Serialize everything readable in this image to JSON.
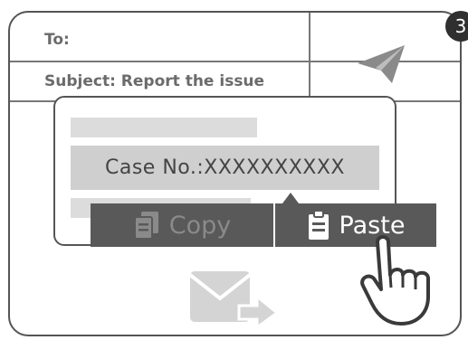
{
  "email": {
    "to_label": "To:",
    "subject_label": "Subject: Report the issue"
  },
  "step_badge": "3",
  "clipboard_text": "Case No.:XXXXXXXXXX",
  "context_menu": {
    "copy_label": "Copy",
    "paste_label": "Paste"
  },
  "colors": {
    "menu_bg": "#595959",
    "case_box_bg": "#cfcfcf",
    "placeholder_bar": "#dcdcdc",
    "outline": "#555555"
  },
  "icons": [
    "send-icon",
    "copy-icon",
    "paste-icon",
    "mail-forward-icon",
    "hand-pointer-icon"
  ]
}
